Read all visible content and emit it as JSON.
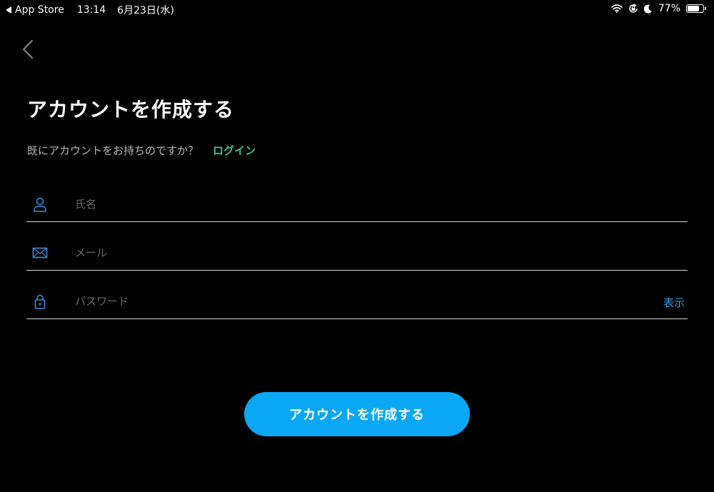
{
  "status_bar": {
    "back_app": "App Store",
    "time": "13:14",
    "date": "6月23日(水)",
    "battery_percent": "77%",
    "battery_level": 0.77,
    "icons": [
      "wifi-icon",
      "rotation-lock-icon",
      "moon-icon",
      "battery-icon"
    ]
  },
  "nav": {
    "back_icon": "chevron-left-icon"
  },
  "page": {
    "title": "アカウントを作成する",
    "login_prompt": "既にアカウントをお持ちのですか？",
    "login_link": "ログイン"
  },
  "form": {
    "name": {
      "placeholder": "氏名",
      "value": "",
      "icon": "person-icon"
    },
    "email": {
      "placeholder": "メール",
      "value": "",
      "icon": "envelope-icon"
    },
    "password": {
      "placeholder": "パスワード",
      "value": "",
      "icon": "lock-icon",
      "show_label": "表示"
    }
  },
  "submit_label": "アカウントを作成する",
  "colors": {
    "background": "#000000",
    "accent_blue": "#0aa8f4",
    "link_green": "#3fc28e",
    "toggle_blue": "#3d9be9",
    "icon_blue": "#3d8fe0"
  }
}
